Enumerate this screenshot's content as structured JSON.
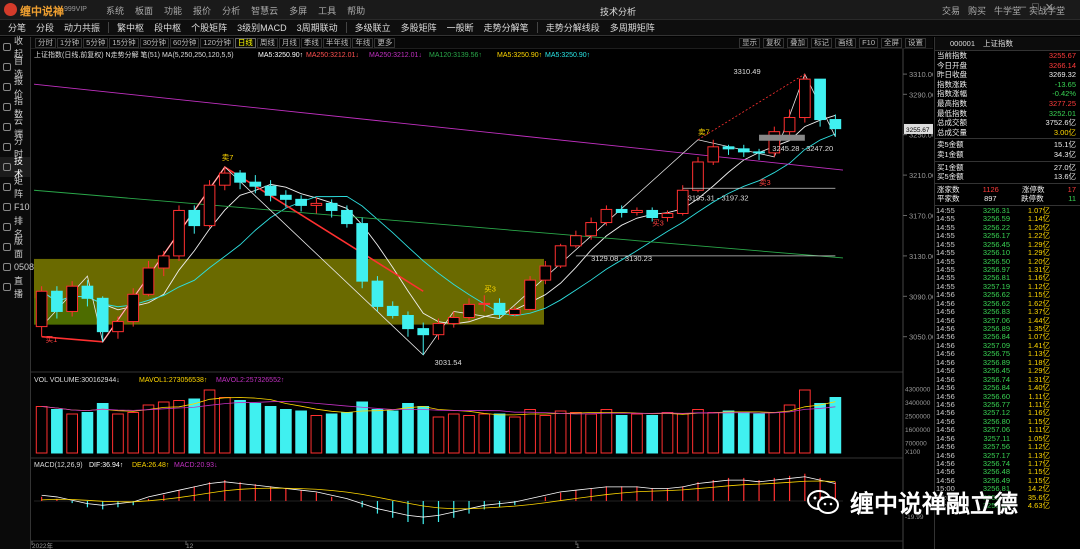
{
  "app": {
    "brand": "缠中说禅",
    "edition": "999VIP",
    "title": "技术分析"
  },
  "menu": [
    "系统",
    "板面",
    "功能",
    "报价",
    "分析",
    "智慧云",
    "多屏",
    "工具",
    "帮助"
  ],
  "account": [
    "交易",
    "购买",
    "牛学堂",
    "实战学堂"
  ],
  "nav": [
    "分笔",
    "分段",
    "动力共振",
    "繁中枢",
    "段中枢",
    "个股矩阵",
    "3级别MACD",
    "3周期联动",
    "多级联立",
    "多股矩阵",
    "一般断",
    "走势分解笔",
    "走势分解线段",
    "多周期矩阵"
  ],
  "sidebar": [
    {
      "label": "收起"
    },
    {
      "label": "自选"
    },
    {
      "label": "报价"
    },
    {
      "label": "指数"
    },
    {
      "label": "云端"
    },
    {
      "label": "分时"
    },
    {
      "label": "技术"
    },
    {
      "label": "矩阵"
    },
    {
      "label": "F10"
    },
    {
      "label": "排名"
    },
    {
      "label": "版面"
    },
    {
      "label": "0508"
    },
    {
      "label": "直播"
    }
  ],
  "timeframes": [
    "分时",
    "1分钟",
    "5分钟",
    "15分钟",
    "30分钟",
    "60分钟",
    "120分钟",
    "日线",
    "周线",
    "月线",
    "季线",
    "半年线",
    "年线",
    "更多"
  ],
  "chart_tools": [
    "显示",
    "复权",
    "叠加",
    "标记",
    "画线",
    "F10",
    "全屏",
    "设置"
  ],
  "legend": {
    "main_title": "上证指数(日线,前复权) N走势分解 笔(51) MA(5,250,250,120,5,5)",
    "ma5": "MA5:3250.90↑",
    "ma250a": "MA250:3212.01↓",
    "ma250b": "MA250:3212.01↓",
    "ma120": "MA120:3139.56↑",
    "ma5b": "MA5:3250.90↑",
    "ma5c": "MA5:3250.90↑"
  },
  "volume_legend": {
    "vol": "VOL VOLUME:300162944↓",
    "mavol1": "MAVOL1:273056538↑",
    "mavol2": "MAVOL2:257326552↑"
  },
  "macd_legend": {
    "label": "MACD(12,26,9)",
    "dif": "DIF:36.94↑",
    "dea": "DEA:26.48↑",
    "macd": "MACD:20.93↓"
  },
  "price_axis": [
    "3310.00",
    "3290.00",
    "3250.00",
    "3210.00",
    "3170.00",
    "3130.00",
    "3090.00",
    "3050.00"
  ],
  "current_price_box": "3255.67",
  "volume_axis": [
    "4300000",
    "3400000",
    "2500000",
    "1600000",
    "700000",
    "X100"
  ],
  "macd_axis": [
    "-19.99"
  ],
  "date_axis": [
    "2022年",
    "12",
    "1"
  ],
  "annotations": {
    "high": "3310.49",
    "low": "3031.54",
    "range1": "3129.08 - 3130.23",
    "range2": "3195.31 - 3197.32",
    "range3": "3245.28 - 3247.20",
    "buy1": "买1",
    "sell7a": "卖7",
    "sell7b": "卖7",
    "buy3": "买3",
    "buy3b": "买3",
    "sell_right": "卖3"
  },
  "chart_data": {
    "type": "candlestick",
    "title": "上证指数(日线,前复权)",
    "ylim": [
      3020,
      3320
    ],
    "x_dates": [
      "2022年",
      "12",
      "1"
    ],
    "candles": [
      [
        3060,
        3095,
        3050,
        3100
      ],
      [
        3095,
        3075,
        3068,
        3100
      ],
      [
        3075,
        3100,
        3070,
        3105
      ],
      [
        3100,
        3088,
        3080,
        3106
      ],
      [
        3088,
        3055,
        3045,
        3090
      ],
      [
        3055,
        3065,
        3048,
        3070
      ],
      [
        3065,
        3092,
        3060,
        3098
      ],
      [
        3092,
        3118,
        3090,
        3125
      ],
      [
        3118,
        3130,
        3110,
        3135
      ],
      [
        3130,
        3175,
        3125,
        3180
      ],
      [
        3175,
        3160,
        3152,
        3180
      ],
      [
        3160,
        3200,
        3158,
        3205
      ],
      [
        3200,
        3212,
        3195,
        3218
      ],
      [
        3212,
        3203,
        3196,
        3215
      ],
      [
        3203,
        3199,
        3192,
        3210
      ],
      [
        3199,
        3190,
        3184,
        3205
      ],
      [
        3190,
        3186,
        3178,
        3195
      ],
      [
        3186,
        3180,
        3174,
        3190
      ],
      [
        3180,
        3182,
        3172,
        3188
      ],
      [
        3182,
        3175,
        3168,
        3186
      ],
      [
        3175,
        3162,
        3158,
        3180
      ],
      [
        3162,
        3105,
        3098,
        3168
      ],
      [
        3105,
        3080,
        3075,
        3110
      ],
      [
        3080,
        3071,
        3068,
        3085
      ],
      [
        3071,
        3058,
        3050,
        3075
      ],
      [
        3058,
        3052,
        3032,
        3064
      ],
      [
        3052,
        3063,
        3047,
        3068
      ],
      [
        3063,
        3069,
        3059,
        3075
      ],
      [
        3069,
        3082,
        3066,
        3088
      ],
      [
        3082,
        3083,
        3075,
        3091
      ],
      [
        3083,
        3072,
        3068,
        3088
      ],
      [
        3072,
        3077,
        3070,
        3080
      ],
      [
        3077,
        3106,
        3076,
        3110
      ],
      [
        3106,
        3120,
        3102,
        3125
      ],
      [
        3120,
        3140,
        3118,
        3142
      ],
      [
        3140,
        3150,
        3138,
        3155
      ],
      [
        3150,
        3163,
        3146,
        3168
      ],
      [
        3163,
        3176,
        3160,
        3180
      ],
      [
        3176,
        3173,
        3168,
        3180
      ],
      [
        3173,
        3175,
        3170,
        3178
      ],
      [
        3175,
        3168,
        3164,
        3178
      ],
      [
        3168,
        3172,
        3164,
        3175
      ],
      [
        3172,
        3195,
        3170,
        3200
      ],
      [
        3195,
        3223,
        3193,
        3228
      ],
      [
        3223,
        3238,
        3220,
        3245
      ],
      [
        3238,
        3236,
        3230,
        3240
      ],
      [
        3236,
        3233,
        3228,
        3240
      ],
      [
        3233,
        3232,
        3225,
        3236
      ],
      [
        3232,
        3253,
        3228,
        3258
      ],
      [
        3253,
        3267,
        3247,
        3275
      ],
      [
        3267,
        3305,
        3262,
        3310
      ],
      [
        3305,
        3265,
        3258,
        3305
      ],
      [
        3265,
        3256,
        3248,
        3270
      ]
    ],
    "volume": [
      3100,
      2900,
      2600,
      2700,
      3300,
      2600,
      2700,
      3200,
      3400,
      3500,
      3600,
      4200,
      3700,
      3500,
      3300,
      3100,
      2900,
      2800,
      2500,
      2600,
      2700,
      3400,
      2900,
      2800,
      3300,
      3100,
      2400,
      2600,
      2500,
      2600,
      2600,
      2400,
      2900,
      2500,
      2800,
      2700,
      2600,
      2900,
      2500,
      2600,
      2500,
      2700,
      2600,
      2900,
      2700,
      2800,
      2700,
      2600,
      2700,
      3200,
      4200,
      3300,
      3700
    ],
    "macd": [
      2,
      1,
      -1,
      -3,
      -4,
      -3,
      -2,
      1,
      3,
      5,
      7,
      9,
      10,
      9,
      8,
      7,
      6,
      5,
      4,
      2,
      0,
      -3,
      -6,
      -8,
      -10,
      -11,
      -10,
      -8,
      -6,
      -4,
      -3,
      -2,
      0,
      2,
      4,
      5,
      6,
      7,
      7,
      7,
      6,
      6,
      7,
      9,
      10,
      11,
      11,
      10,
      11,
      12,
      13,
      11,
      9
    ]
  },
  "quote": {
    "code": "000001",
    "name": "上证指数",
    "rows": [
      {
        "label": "当前指数",
        "value": "3255.67",
        "color": "red"
      },
      {
        "label": "今日开盘",
        "value": "3266.14",
        "color": "red"
      },
      {
        "label": "昨日收盘",
        "value": "3269.32",
        "color": "white"
      },
      {
        "label": "指数涨跌",
        "value": "-13.65",
        "color": "green"
      },
      {
        "label": "指数涨幅",
        "value": "-0.42%",
        "color": "green"
      },
      {
        "label": "最高指数",
        "value": "3277.25",
        "color": "red"
      },
      {
        "label": "最低指数",
        "value": "3252.01",
        "color": "green"
      },
      {
        "label": "总成交额",
        "value": "3752.6亿",
        "color": "white"
      },
      {
        "label": "总成交量",
        "value": "3.00亿",
        "color": "yellow"
      }
    ],
    "rows2": [
      {
        "label": "卖5金额",
        "value": "15.1亿",
        "color": "white"
      },
      {
        "label": "卖1金额",
        "value": "34.3亿",
        "color": "white"
      }
    ],
    "rows3": [
      {
        "label": "买1金额",
        "value": "27.0亿",
        "color": "white"
      },
      {
        "label": "买5金额",
        "value": "13.6亿",
        "color": "white"
      }
    ],
    "breadth": [
      {
        "label": "涨家数",
        "value": "1126",
        "label2": "涨停数",
        "value2": "17"
      },
      {
        "label": "平家数",
        "value": "897",
        "label2": "跌停数",
        "value2": "11"
      }
    ]
  },
  "ticks": [
    [
      "14:55",
      "3256.31",
      "1.07亿"
    ],
    [
      "14:55",
      "3256.59",
      "1.14亿"
    ],
    [
      "14:55",
      "3256.22",
      "1.20亿"
    ],
    [
      "14:55",
      "3256.17",
      "1.22亿"
    ],
    [
      "14:55",
      "3256.45",
      "1.29亿"
    ],
    [
      "14:55",
      "3256.10",
      "1.29亿"
    ],
    [
      "14:55",
      "3256.50",
      "1.20亿"
    ],
    [
      "14:55",
      "3256.97",
      "1.31亿"
    ],
    [
      "14:55",
      "3256.81",
      "1.16亿"
    ],
    [
      "14:55",
      "3257.19",
      "1.12亿"
    ],
    [
      "14:56",
      "3256.62",
      "1.15亿"
    ],
    [
      "14:56",
      "3256.62",
      "1.62亿"
    ],
    [
      "14:56",
      "3256.83",
      "1.37亿"
    ],
    [
      "14:56",
      "3257.06",
      "1.44亿"
    ],
    [
      "14:56",
      "3256.89",
      "1.35亿"
    ],
    [
      "14:56",
      "3256.84",
      "1.07亿"
    ],
    [
      "14:56",
      "3257.09",
      "1.41亿"
    ],
    [
      "14:56",
      "3256.75",
      "1.13亿"
    ],
    [
      "14:56",
      "3256.89",
      "1.18亿"
    ],
    [
      "14:56",
      "3256.45",
      "1.29亿"
    ],
    [
      "14:56",
      "3256.74",
      "1.31亿"
    ],
    [
      "14:56",
      "3256.84",
      "1.40亿"
    ],
    [
      "14:56",
      "3256.60",
      "1.11亿"
    ],
    [
      "14:56",
      "3256.77",
      "1.11亿"
    ],
    [
      "14:56",
      "3257.12",
      "1.16亿"
    ],
    [
      "14:56",
      "3256.80",
      "1.15亿"
    ],
    [
      "14:56",
      "3257.06",
      "1.11亿"
    ],
    [
      "14:56",
      "3257.11",
      "1.05亿"
    ],
    [
      "14:56",
      "3257.56",
      "1.12亿"
    ],
    [
      "14:56",
      "3257.17",
      "1.13亿"
    ],
    [
      "14:56",
      "3256.74",
      "1.17亿"
    ],
    [
      "14:56",
      "3256.48",
      "1.15亿"
    ],
    [
      "14:56",
      "3256.49",
      "1.15亿"
    ],
    [
      "15:00",
      "3256.81",
      "14.2亿"
    ],
    [
      "15:00",
      "3255.90",
      "35.6亿"
    ],
    [
      "15:00",
      "3255.67",
      "4.63亿"
    ]
  ],
  "watermark": "缠中说禅融立德"
}
